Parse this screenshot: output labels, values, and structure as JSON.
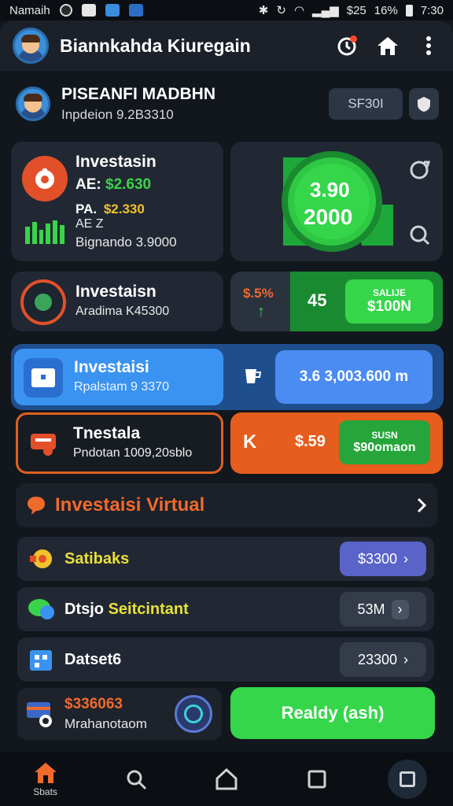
{
  "status_bar": {
    "carrier": "Namaih",
    "battery_text": "$25",
    "battery_percent": "16%",
    "time": "7:30"
  },
  "app_bar": {
    "title": "Biannkahda Kiuregain"
  },
  "profile": {
    "name": "PISEANFI MADBHN",
    "subtitle": "Inpdeion 9.2B3310",
    "chip_label": "SF30I"
  },
  "cards": {
    "investment_top": {
      "title": "Investasin",
      "line1_prefix": "AE:",
      "line1_value": "$2.630",
      "line2_prefix": "PA.",
      "line2_value": "$2.330",
      "line3": "AE Z",
      "line4": "Bignando 3.9000"
    },
    "circle": {
      "value1": "3.90",
      "value2": "2000"
    },
    "investment_mid": {
      "title": "Investaisn",
      "subtitle": "Aradima K45300"
    },
    "mid_right": {
      "percent": "$.5%",
      "badge": "45",
      "button_line1": "SALIJE",
      "button_line2": "$100N"
    },
    "investment_blue": {
      "title": "Investaisi",
      "subtitle": "Rpalstam 9 3370"
    },
    "blue_right": {
      "value": "3.6 3,003.600 m"
    },
    "investment_orange": {
      "title": "Tnestala",
      "subtitle": "Pndotan 1009,20sblo"
    },
    "orange_right": {
      "letter": "K",
      "value": "$.59",
      "button_line1": "SUSN",
      "button_line2": "$90omaon"
    }
  },
  "virtual_row": {
    "label": "Investaisi Virtual"
  },
  "list": [
    {
      "name": "Satibaks",
      "value": "$3300",
      "name_color": "#e8e03a",
      "pill_color": "#5a63c8"
    },
    {
      "name_part1": "Dtsjo",
      "name_part2": "Seitcintant",
      "value": "53M",
      "pill_color": "#343c49"
    },
    {
      "name": "Datset6",
      "value": "23300",
      "pill_color": "#343c49"
    }
  ],
  "bottom_card": {
    "amount": "$336063",
    "label": "Mrahanotaom"
  },
  "cta": {
    "label": "Realdy (ash)"
  },
  "nav": {
    "home_label": "Sbats"
  },
  "colors": {
    "accent_green": "#35d64a",
    "accent_orange": "#e65d1d",
    "accent_blue": "#3a93f0",
    "background": "#12161d"
  }
}
